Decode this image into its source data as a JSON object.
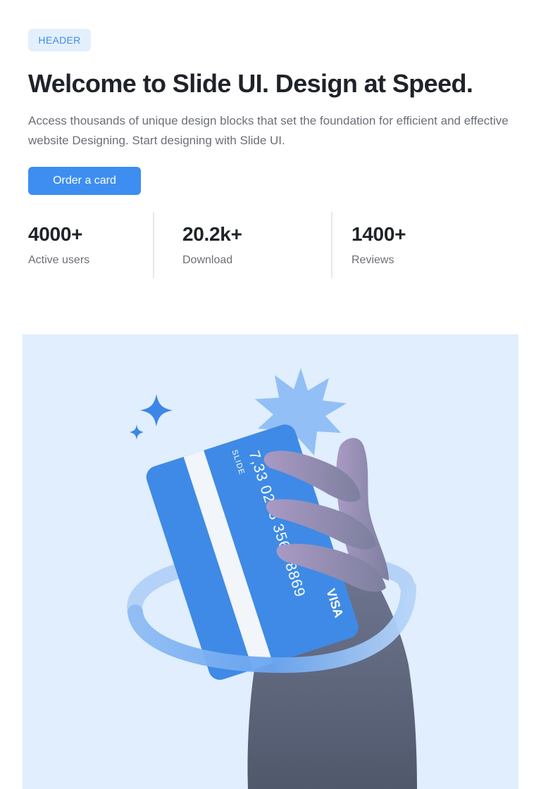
{
  "header": {
    "badge": "HEADER",
    "title": "Welcome to Slide UI. Design at Speed.",
    "description": "Access thousands of unique design blocks that set the foundation for efficient and effective website Designing. Start designing with Slide UI.",
    "cta_label": "Order a card"
  },
  "stats": [
    {
      "value": "4000+",
      "label": "Active users"
    },
    {
      "value": "20.2k+",
      "label": "Download"
    },
    {
      "value": "1400+",
      "label": "Reviews"
    }
  ],
  "card": {
    "brand": "SLIDE",
    "number": "7,33 0288 3564 8869",
    "network": "VISA"
  },
  "colors": {
    "accent": "#3d8ef0",
    "badge_bg": "#e3effd",
    "hero_bg": "#e0eefd",
    "card": "#3f8ae6"
  }
}
